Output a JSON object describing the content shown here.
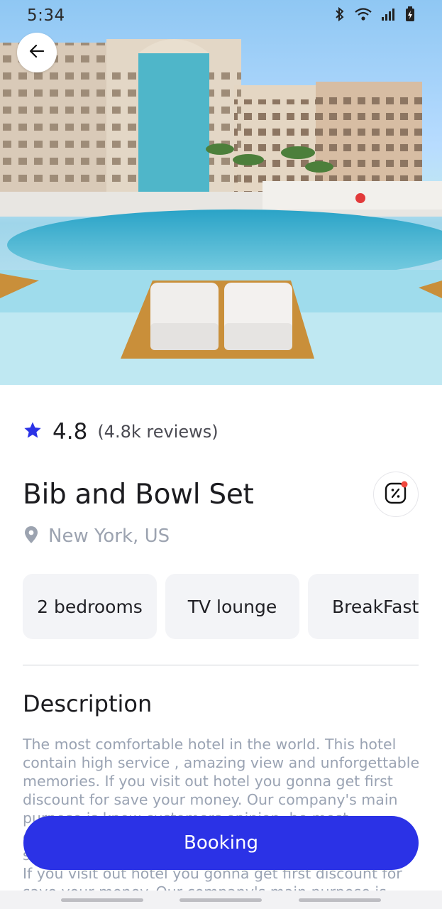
{
  "status_bar": {
    "time": "5:34",
    "icons": [
      "bluetooth-icon",
      "wifi-icon",
      "signal-icon",
      "battery-charging-icon"
    ]
  },
  "hero": {
    "image_alt": "Hotel with pool",
    "back_icon": "arrow-left-icon"
  },
  "rating": {
    "icon": "star-icon",
    "value": "4.8",
    "reviews": "(4.8k reviews)",
    "star_color": "#2b32e6"
  },
  "listing": {
    "title": "Bib and Bowl Set",
    "promo_icon": "discount-icon",
    "location_icon": "location-pin-icon",
    "location": "New York, US"
  },
  "features": [
    "2 bedrooms",
    "TV lounge",
    "BreakFast"
  ],
  "description": {
    "heading": "Description",
    "text": "The most comfortable hotel in the world. This hotel contain high service , amazing view and unforgettable memories. If you visit out hotel you gonna get first discount for save your money. Our company's main purpose is know customers opinion, be most comfortable hotel in the world. This hotel contain high service , amazing view and unforgettable memories. If you visit out hotel you gonna get first discount for save your money. Our company's main purpose is know customers opinion, be most"
  },
  "actions": {
    "booking_label": "Booking"
  },
  "colors": {
    "accent": "#2b32e6",
    "notification_dot": "#f0483e"
  }
}
